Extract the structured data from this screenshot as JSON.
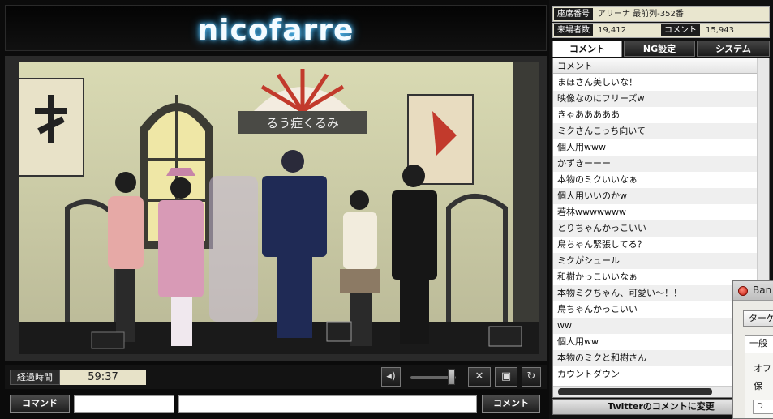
{
  "header": {
    "logo": "nicofarre"
  },
  "player": {
    "elapsed_label": "経過時間",
    "elapsed_time": "59:37",
    "volume_level": 0.9,
    "command_button": "コマンド",
    "comment_button": "コメント",
    "command_input_value": "",
    "comment_input_value": ""
  },
  "info": {
    "seat_label": "座席番号",
    "seat_value": "アリーナ 最前列-352番",
    "visitors_label": "来場者数",
    "visitors_value": "19,412",
    "comments_label": "コメント",
    "comments_value": "15,943"
  },
  "tabs": [
    "コメント",
    "NG設定",
    "システム"
  ],
  "comment_list": {
    "header": "コメント",
    "rows": [
      "まほさん美しいな！",
      "映像なのにフリーズw",
      "きゃあああああ",
      "ミクさんこっち向いて",
      "個人用www",
      "かずきーーー",
      "本物のミクいいなぁ",
      "個人用いいのかw",
      "若林wwwwwww",
      "とりちゃんかっこいい",
      "鳥ちゃん緊張してる？",
      "ミクがシュール",
      "和樹かっこいいなぁ",
      "本物ミクちゃん、可愛い〜！！",
      "鳥ちゃんかっこいい",
      "ww",
      "個人用ww",
      "本物のミクと和樹さん",
      "カウントダウン"
    ]
  },
  "twitter_bar": "Twitterのコメントに変更",
  "popup": {
    "title": "Ban",
    "button": "ターゲ",
    "tab": "一般",
    "line1": "オフ",
    "line2": "保",
    "field": "D"
  },
  "stage_sign": "るう症くるみ",
  "colors": {
    "logo_glow": "#5fc8ff",
    "panel_bg": "#101010",
    "info_bg": "#e9e6cf"
  }
}
